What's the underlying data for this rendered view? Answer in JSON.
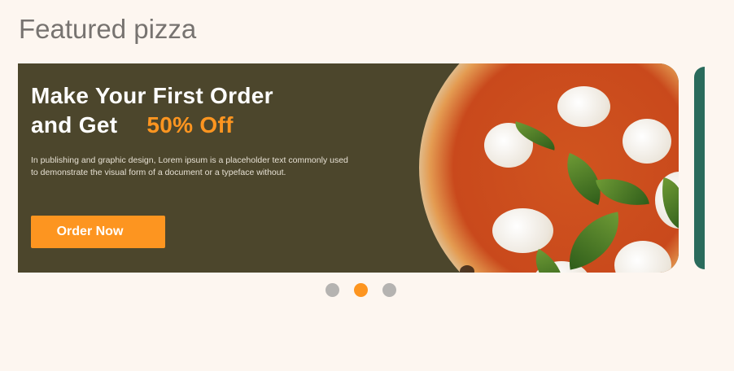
{
  "section_title": "Featured pizza",
  "banner": {
    "headline_line1": "Make Your First Order",
    "headline_line2": "and Get",
    "highlight": "50% Off",
    "description": "In publishing and graphic design, Lorem ipsum is a placeholder text commonly used to demonstrate the visual form of a document or a typeface without.",
    "cta_label": "Order Now",
    "colors": {
      "background": "#4c462c",
      "accent": "#fd9520",
      "next_card": "#2a6b5c"
    }
  },
  "carousel": {
    "slide_count": 3,
    "active_index": 1
  }
}
